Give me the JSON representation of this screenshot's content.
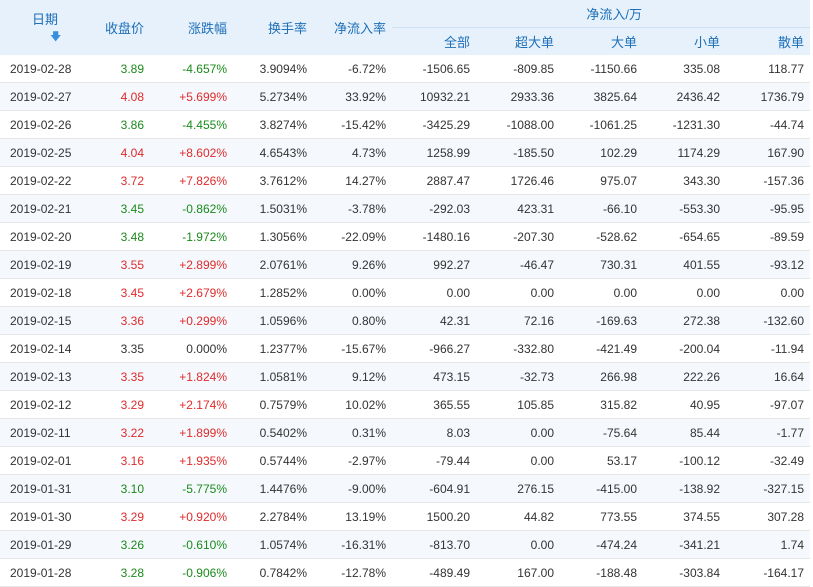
{
  "headers": {
    "date": "日期",
    "close": "收盘价",
    "change": "涨跌幅",
    "turnover": "换手率",
    "net_ratio": "净流入率",
    "net_group": "净流入/万",
    "all": "全部",
    "super": "超大单",
    "large": "大单",
    "small": "小单",
    "retail": "散单"
  },
  "sort_icon": "arrow-down-icon",
  "colors": {
    "up": "#e02a2a",
    "down": "#1a8a1a",
    "header_bg": "#e7f1fb",
    "header_text": "#1d6fb8"
  },
  "rows": [
    {
      "date": "2019-02-28",
      "close": "3.89",
      "change": "-4.657%",
      "turnover": "3.9094%",
      "net_ratio": "-6.72%",
      "all": "-1506.65",
      "super": "-809.85",
      "large": "-1150.66",
      "small": "335.08",
      "retail": "118.77",
      "dir": "down"
    },
    {
      "date": "2019-02-27",
      "close": "4.08",
      "change": "+5.699%",
      "turnover": "5.2734%",
      "net_ratio": "33.92%",
      "all": "10932.21",
      "super": "2933.36",
      "large": "3825.64",
      "small": "2436.42",
      "retail": "1736.79",
      "dir": "up"
    },
    {
      "date": "2019-02-26",
      "close": "3.86",
      "change": "-4.455%",
      "turnover": "3.8274%",
      "net_ratio": "-15.42%",
      "all": "-3425.29",
      "super": "-1088.00",
      "large": "-1061.25",
      "small": "-1231.30",
      "retail": "-44.74",
      "dir": "down"
    },
    {
      "date": "2019-02-25",
      "close": "4.04",
      "change": "+8.602%",
      "turnover": "4.6543%",
      "net_ratio": "4.73%",
      "all": "1258.99",
      "super": "-185.50",
      "large": "102.29",
      "small": "1174.29",
      "retail": "167.90",
      "dir": "up"
    },
    {
      "date": "2019-02-22",
      "close": "3.72",
      "change": "+7.826%",
      "turnover": "3.7612%",
      "net_ratio": "14.27%",
      "all": "2887.47",
      "super": "1726.46",
      "large": "975.07",
      "small": "343.30",
      "retail": "-157.36",
      "dir": "up"
    },
    {
      "date": "2019-02-21",
      "close": "3.45",
      "change": "-0.862%",
      "turnover": "1.5031%",
      "net_ratio": "-3.78%",
      "all": "-292.03",
      "super": "423.31",
      "large": "-66.10",
      "small": "-553.30",
      "retail": "-95.95",
      "dir": "down"
    },
    {
      "date": "2019-02-20",
      "close": "3.48",
      "change": "-1.972%",
      "turnover": "1.3056%",
      "net_ratio": "-22.09%",
      "all": "-1480.16",
      "super": "-207.30",
      "large": "-528.62",
      "small": "-654.65",
      "retail": "-89.59",
      "dir": "down"
    },
    {
      "date": "2019-02-19",
      "close": "3.55",
      "change": "+2.899%",
      "turnover": "2.0761%",
      "net_ratio": "9.26%",
      "all": "992.27",
      "super": "-46.47",
      "large": "730.31",
      "small": "401.55",
      "retail": "-93.12",
      "dir": "up"
    },
    {
      "date": "2019-02-18",
      "close": "3.45",
      "change": "+2.679%",
      "turnover": "1.2852%",
      "net_ratio": "0.00%",
      "all": "0.00",
      "super": "0.00",
      "large": "0.00",
      "small": "0.00",
      "retail": "0.00",
      "dir": "up"
    },
    {
      "date": "2019-02-15",
      "close": "3.36",
      "change": "+0.299%",
      "turnover": "1.0596%",
      "net_ratio": "0.80%",
      "all": "42.31",
      "super": "72.16",
      "large": "-169.63",
      "small": "272.38",
      "retail": "-132.60",
      "dir": "up"
    },
    {
      "date": "2019-02-14",
      "close": "3.35",
      "change": "0.000%",
      "turnover": "1.2377%",
      "net_ratio": "-15.67%",
      "all": "-966.27",
      "super": "-332.80",
      "large": "-421.49",
      "small": "-200.04",
      "retail": "-11.94",
      "dir": "flat"
    },
    {
      "date": "2019-02-13",
      "close": "3.35",
      "change": "+1.824%",
      "turnover": "1.0581%",
      "net_ratio": "9.12%",
      "all": "473.15",
      "super": "-32.73",
      "large": "266.98",
      "small": "222.26",
      "retail": "16.64",
      "dir": "up"
    },
    {
      "date": "2019-02-12",
      "close": "3.29",
      "change": "+2.174%",
      "turnover": "0.7579%",
      "net_ratio": "10.02%",
      "all": "365.55",
      "super": "105.85",
      "large": "315.82",
      "small": "40.95",
      "retail": "-97.07",
      "dir": "up"
    },
    {
      "date": "2019-02-11",
      "close": "3.22",
      "change": "+1.899%",
      "turnover": "0.5402%",
      "net_ratio": "0.31%",
      "all": "8.03",
      "super": "0.00",
      "large": "-75.64",
      "small": "85.44",
      "retail": "-1.77",
      "dir": "up"
    },
    {
      "date": "2019-02-01",
      "close": "3.16",
      "change": "+1.935%",
      "turnover": "0.5744%",
      "net_ratio": "-2.97%",
      "all": "-79.44",
      "super": "0.00",
      "large": "53.17",
      "small": "-100.12",
      "retail": "-32.49",
      "dir": "up"
    },
    {
      "date": "2019-01-31",
      "close": "3.10",
      "change": "-5.775%",
      "turnover": "1.4476%",
      "net_ratio": "-9.00%",
      "all": "-604.91",
      "super": "276.15",
      "large": "-415.00",
      "small": "-138.92",
      "retail": "-327.15",
      "dir": "down"
    },
    {
      "date": "2019-01-30",
      "close": "3.29",
      "change": "+0.920%",
      "turnover": "2.2784%",
      "net_ratio": "13.19%",
      "all": "1500.20",
      "super": "44.82",
      "large": "773.55",
      "small": "374.55",
      "retail": "307.28",
      "dir": "up"
    },
    {
      "date": "2019-01-29",
      "close": "3.26",
      "change": "-0.610%",
      "turnover": "1.0574%",
      "net_ratio": "-16.31%",
      "all": "-813.70",
      "super": "0.00",
      "large": "-474.24",
      "small": "-341.21",
      "retail": "1.74",
      "dir": "down"
    },
    {
      "date": "2019-01-28",
      "close": "3.28",
      "change": "-0.906%",
      "turnover": "0.7842%",
      "net_ratio": "-12.78%",
      "all": "-489.49",
      "super": "167.00",
      "large": "-188.48",
      "small": "-303.84",
      "retail": "-164.17",
      "dir": "down"
    }
  ]
}
